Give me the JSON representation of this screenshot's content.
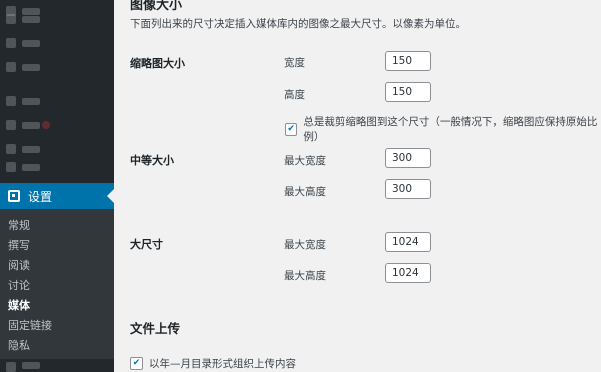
{
  "sidebar": {
    "active_label": "设置",
    "submenu": [
      "常规",
      "撰写",
      "阅读",
      "讨论",
      "媒体",
      "固定链接",
      "隐私"
    ],
    "current_index": 4
  },
  "main": {
    "section_title": "图像大小",
    "description": "下面列出来的尺寸决定插入媒体库内的图像之最大尺寸。以像素为单位。",
    "thumbnail": {
      "label": "缩略图大小",
      "width_label": "宽度",
      "width_value": "150",
      "height_label": "高度",
      "height_value": "150",
      "crop_label": "总是裁剪缩略图到这个尺寸（一般情况下，缩略图应保持原始比例）",
      "crop_checked": true
    },
    "medium": {
      "label": "中等大小",
      "max_width_label": "最大宽度",
      "max_width_value": "300",
      "max_height_label": "最大高度",
      "max_height_value": "300"
    },
    "large": {
      "label": "大尺寸",
      "max_width_label": "最大宽度",
      "max_width_value": "1024",
      "max_height_label": "最大高度",
      "max_height_value": "1024"
    },
    "uploads_title": "文件上传",
    "uploads_checkbox_label": "以年—月目录形式组织上传内容",
    "uploads_checked": true
  }
}
